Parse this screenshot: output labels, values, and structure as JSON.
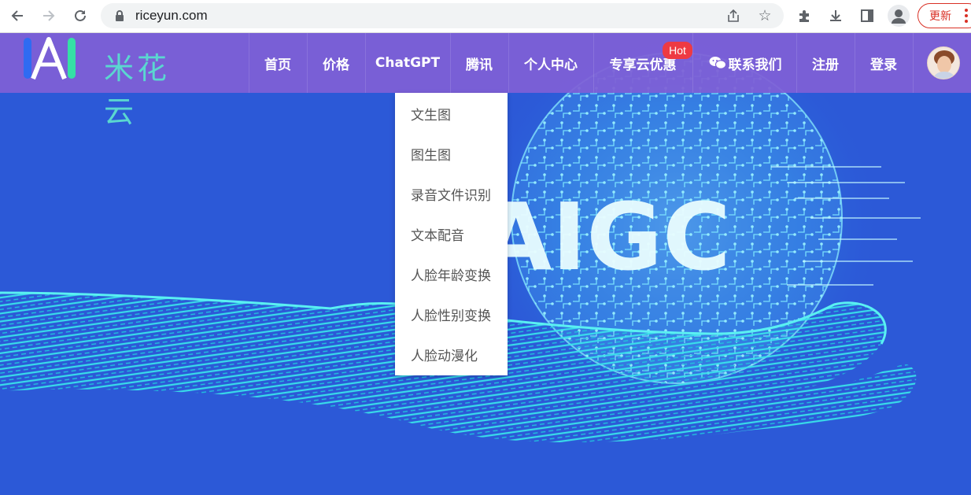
{
  "browser": {
    "url": "riceyun.com",
    "update_label": "更新"
  },
  "site": {
    "logo_text": "米花云",
    "nav": [
      {
        "label": "首页"
      },
      {
        "label": "价格"
      },
      {
        "label": "ChatGPT"
      },
      {
        "label": "腾讯"
      },
      {
        "label": "个人中心"
      },
      {
        "label": "专享云优惠"
      },
      {
        "label": "联系我们"
      },
      {
        "label": "注册"
      },
      {
        "label": "登录"
      }
    ],
    "hot_badge": "Hot"
  },
  "dropdown": {
    "items": [
      {
        "label": "文生图"
      },
      {
        "label": "图生图"
      },
      {
        "label": "录音文件识别"
      },
      {
        "label": "文本配音"
      },
      {
        "label": "人脸年龄变换"
      },
      {
        "label": "人脸性别变换"
      },
      {
        "label": "人脸动漫化"
      }
    ]
  },
  "hero": {
    "headline": "AIGC"
  },
  "icons": {
    "back": "arrow-left-icon",
    "forward": "arrow-right-icon",
    "reload": "reload-icon",
    "lock": "lock-icon",
    "share": "share-icon",
    "star": "star-icon",
    "extensions": "puzzle-icon",
    "download": "download-icon",
    "side_panel": "side-panel-icon",
    "profile": "profile-icon",
    "menu": "kebab-menu-icon",
    "wechat": "wechat-icon"
  },
  "colors": {
    "header_bg": "#7f60d6",
    "hero_bg": "#2c59d7",
    "hot_badge": "#ee3a43",
    "logo_text": "#5ad7d0",
    "update_accent": "#d93025"
  }
}
